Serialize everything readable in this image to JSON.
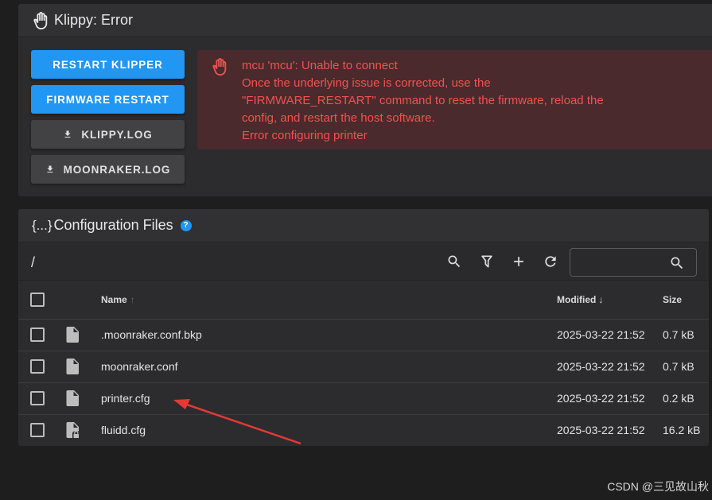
{
  "klippy": {
    "title": "Klippy: Error",
    "buttons": {
      "restart_klipper": "RESTART KLIPPER",
      "firmware_restart": "FIRMWARE RESTART",
      "klippy_log": "KLIPPY.LOG",
      "moonraker_log": "MOONRAKER.LOG"
    },
    "error_lines": [
      "mcu 'mcu': Unable to connect",
      "Once the underlying issue is corrected, use the",
      "\"FIRMWARE_RESTART\" command to reset the firmware, reload the",
      "config, and restart the host software.",
      "Error configuring printer"
    ]
  },
  "config": {
    "title_prefix": "{...}",
    "title": "Configuration Files",
    "help_glyph": "?",
    "path": "/",
    "search_placeholder": "",
    "columns": {
      "name": "Name",
      "modified": "Modified",
      "size": "Size"
    },
    "files": [
      {
        "name": ".moonraker.conf.bkp",
        "modified": "2025-03-22 21:52",
        "size": "0.7 kB",
        "icon": "file-icon"
      },
      {
        "name": "moonraker.conf",
        "modified": "2025-03-22 21:52",
        "size": "0.7 kB",
        "icon": "file-icon"
      },
      {
        "name": "printer.cfg",
        "modified": "2025-03-22 21:52",
        "size": "0.2 kB",
        "icon": "file-icon"
      },
      {
        "name": "fluidd.cfg",
        "modified": "2025-03-22 21:52",
        "size": "16.2 kB",
        "icon": "file-lock-icon"
      }
    ]
  },
  "watermark": "CSDN @三见故山秋",
  "colors": {
    "primary": "#2196f3",
    "error_text": "#ef5350",
    "error_bg": "#4a2a2c",
    "annotation": "#e53935"
  }
}
